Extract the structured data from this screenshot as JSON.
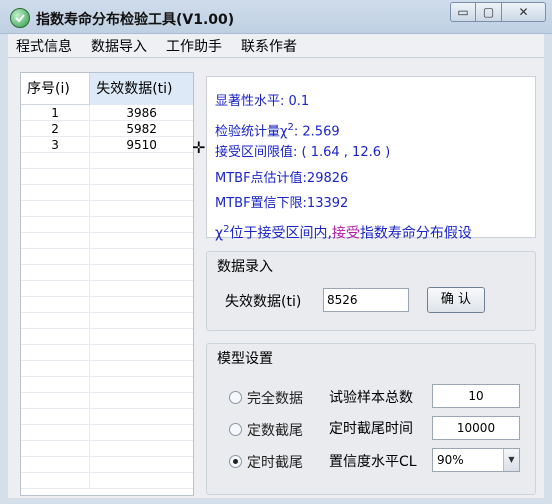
{
  "window": {
    "title": "指数寿命分布检验工具(V1.00)",
    "controls": {
      "minimize": "▭",
      "maximize": "▢",
      "close": "✕"
    }
  },
  "menu": [
    "程式信息",
    "数据导入",
    "工作助手",
    "联系作者"
  ],
  "table": {
    "headers": [
      "序号(i)",
      "失效数据(ti)"
    ],
    "rows": [
      [
        "1",
        "3986"
      ],
      [
        "2",
        "5982"
      ],
      [
        "3",
        "9510"
      ]
    ]
  },
  "results": {
    "significance": "显著性水平: 0.1",
    "statistic_prefix": "检验统计量χ",
    "statistic_exp": "2",
    "statistic_value": ": 2.569",
    "interval": "接受区间限值: ( 1.64 , 12.6 )",
    "mtbf_point": "MTBF点估计值:29826",
    "mtbf_lower": "MTBF置信下限:13392",
    "conclusion_prefix": "χ",
    "conclusion_exp": "2",
    "conclusion_mid": "位于接受区间内,",
    "conclusion_highlight": "接受",
    "conclusion_suffix": "指数寿命分布假设"
  },
  "entry": {
    "group_title": "数据录入",
    "label": "失效数据(ti)",
    "value": "8526",
    "button": "确 认"
  },
  "model": {
    "group_title": "模型设置",
    "options": [
      {
        "label": "完全数据",
        "selected": false
      },
      {
        "label": "定数截尾",
        "selected": false
      },
      {
        "label": "定时截尾",
        "selected": true
      }
    ],
    "sample_label": "试验样本总数",
    "sample_value": "10",
    "time_label": "定时截尾时间",
    "time_value": "10000",
    "confidence_label": "置信度水平CL",
    "confidence_value": "90%"
  },
  "colors": {
    "result_text": "#1a24c8",
    "highlight": "#b31ba8"
  }
}
